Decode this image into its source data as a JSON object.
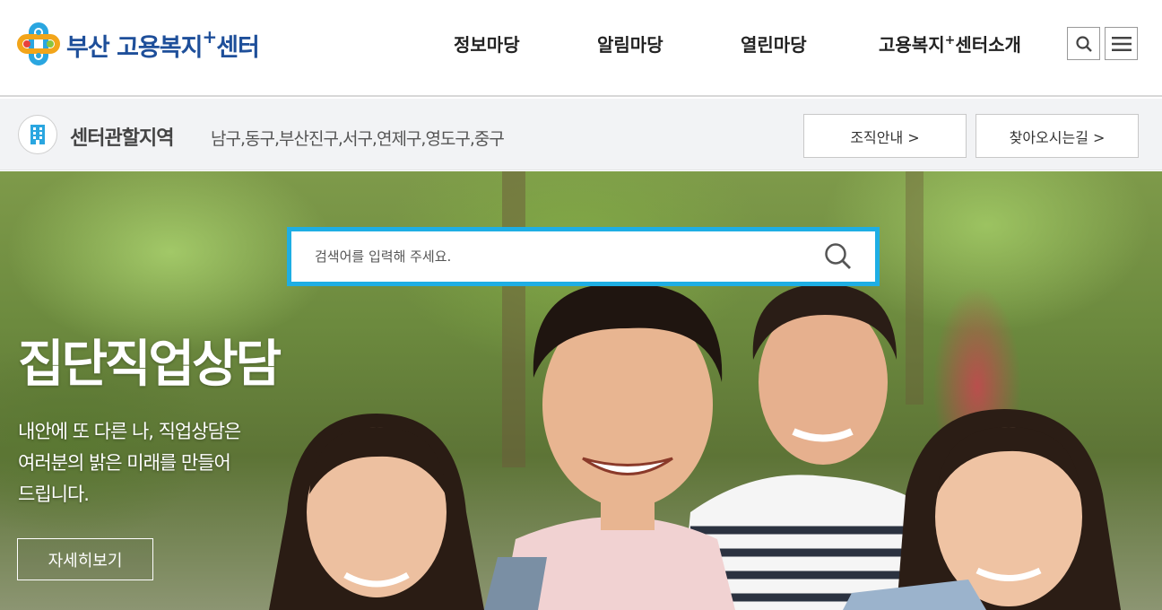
{
  "header": {
    "logo": {
      "text_main": "부산 고용복지",
      "text_sup": "+",
      "text_tail": "센터"
    },
    "nav": [
      {
        "label": "정보마당"
      },
      {
        "label": "알림마당"
      },
      {
        "label": "열린마당"
      },
      {
        "label": "고용복지",
        "sup": "+",
        "tail": "센터소개"
      }
    ],
    "icons": {
      "search": "search-icon",
      "menu": "hamburger-menu-icon"
    }
  },
  "subbar": {
    "title": "센터관할지역",
    "areas": "남구,동구,부산진구,서구,연제구,영도구,중구",
    "buttons": [
      {
        "label": "조직안내 >"
      },
      {
        "label": "찾아오시는길 >"
      }
    ]
  },
  "hero": {
    "search": {
      "placeholder": "검색어를 입력해 주세요.",
      "value": ""
    },
    "title": "집단직업상담",
    "description_lines": [
      "내안에 또 다른 나, 직업상담은",
      "여러분의 밝은 미래를 만들어",
      "드립니다."
    ],
    "button_label": "자세히보기"
  },
  "colors": {
    "brand_blue": "#1e4f9a",
    "search_border": "#1eaee4",
    "subbar_bg": "#f2f3f5"
  }
}
